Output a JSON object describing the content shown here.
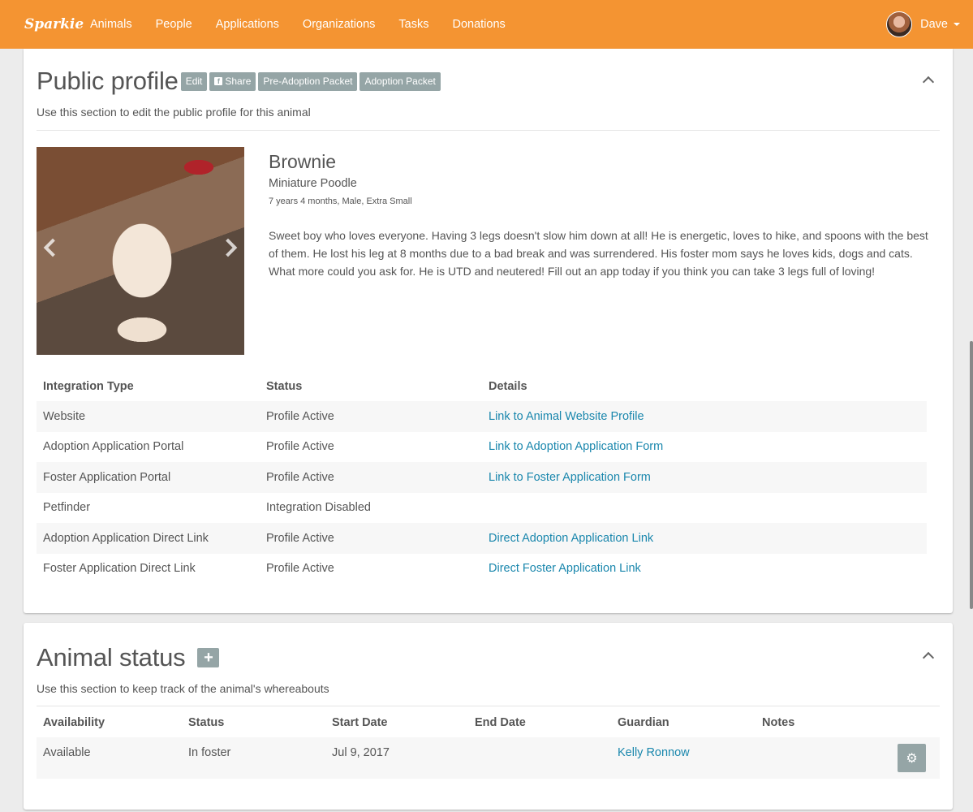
{
  "navbar": {
    "brand": "Sparkie",
    "items": [
      "Animals",
      "People",
      "Applications",
      "Organizations",
      "Tasks",
      "Donations"
    ],
    "user_name": "Dave"
  },
  "profile": {
    "title": "Public profile",
    "buttons": {
      "edit": "Edit",
      "share": "Share",
      "pre_adoption": "Pre-Adoption Packet",
      "adoption": "Adoption Packet"
    },
    "subtitle": "Use this section to edit the public profile for this animal",
    "animal": {
      "name": "Brownie",
      "breed": "Miniature Poodle",
      "meta": "7 years 4 months, Male, Extra Small",
      "description": "Sweet boy who loves everyone. Having 3 legs doesn't slow him down at all! He is energetic, loves to hike, and spoons with the best of them.  He lost his leg at 8 months due to a bad break and was surrendered. His foster mom says he loves kids, dogs and cats. What more could you ask for. He is UTD and neutered! Fill out an app today if you think you can take 3 legs full of loving!"
    },
    "table": {
      "headers": [
        "Integration Type",
        "Status",
        "Details"
      ],
      "rows": [
        {
          "type": "Website",
          "status": "Profile Active",
          "details": "Link to Animal Website Profile"
        },
        {
          "type": "Adoption Application Portal",
          "status": "Profile Active",
          "details": "Link to Adoption Application Form"
        },
        {
          "type": "Foster Application Portal",
          "status": "Profile Active",
          "details": "Link to Foster Application Form"
        },
        {
          "type": "Petfinder",
          "status": "Integration Disabled",
          "details": ""
        },
        {
          "type": "Adoption Application Direct Link",
          "status": "Profile Active",
          "details": "Direct Adoption Application Link"
        },
        {
          "type": "Foster Application Direct Link",
          "status": "Profile Active",
          "details": "Direct Foster Application Link"
        }
      ]
    }
  },
  "status_section": {
    "title": "Animal status",
    "subtitle": "Use this section to keep track of the animal's whereabouts",
    "headers": [
      "Availability",
      "Status",
      "Start Date",
      "End Date",
      "Guardian",
      "Notes"
    ],
    "rows": [
      {
        "availability": "Available",
        "status": "In foster",
        "start_date": "Jul 9, 2017",
        "end_date": "",
        "guardian": "Kelly Ronnow",
        "notes": ""
      }
    ]
  },
  "colors": {
    "navbar": "#f49432",
    "button_gray": "#95a5a6",
    "link": "#1a87ad"
  },
  "icons": {
    "share": "facebook-icon",
    "collapse": "chevron-up-icon",
    "add": "plus-icon",
    "settings": "gear-icon",
    "menu": "caret-down-icon"
  }
}
